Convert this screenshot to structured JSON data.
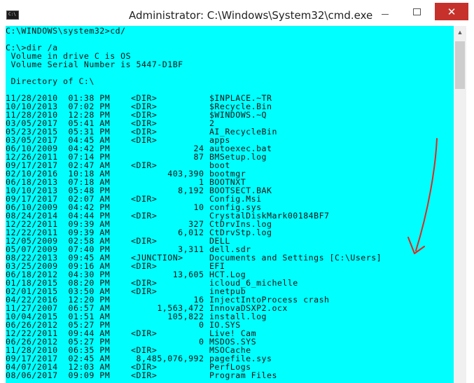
{
  "window": {
    "title": "Administrator: C:\\Windows\\System32\\cmd.exe",
    "icon_text": "C:\\",
    "controls": {
      "minimize": "minimize-icon",
      "maximize": "maximize-icon",
      "close": "✕"
    }
  },
  "colors": {
    "console_bg": "#00ffff",
    "console_text": "#111111",
    "close_bg": "#c7312b",
    "arrow": "#e0281e"
  },
  "console": {
    "lines": [
      "C:\\WINDOWS\\system32>cd/",
      "",
      "C:\\>dir /a",
      " Volume in drive C is OS",
      " Volume Serial Number is 5447-D1BF",
      "",
      " Directory of C:\\",
      "",
      "11/28/2010  01:38 PM    <DIR>          $INPLACE.~TR",
      "10/10/2013  07:02 PM    <DIR>          $Recycle.Bin",
      "11/28/2010  12:28 PM    <DIR>          $WINDOWS.~Q",
      "03/05/2017  05:41 AM    <DIR>          2",
      "05/23/2015  05:31 PM    <DIR>          AI_RecycleBin",
      "03/05/2017  04:45 AM    <DIR>          apps",
      "06/10/2009  04:42 PM                24 autoexec.bat",
      "12/26/2011  07:14 PM                87 BMSetup.log",
      "09/17/2017  02:47 AM    <DIR>          boot",
      "02/10/2016  10:18 AM           403,390 bootmgr",
      "06/18/2013  07:18 AM                 1 BOOTNXT",
      "10/10/2013  05:48 PM             8,192 BOOTSECT.BAK",
      "09/17/2017  02:07 AM    <DIR>          Config.Msi",
      "06/10/2009  04:42 PM                10 config.sys",
      "08/24/2014  04:44 PM    <DIR>          CrystalDiskMark00184BF7",
      "12/22/2011  09:39 AM               327 CtDrvIns.log",
      "12/22/2011  09:39 AM             6,012 CtDrvStp.log",
      "12/05/2009  02:58 AM    <DIR>          DELL",
      "05/07/2009  07:40 PM             3,311 dell.sdr",
      "08/22/2013  09:45 AM    <JUNCTION>     Documents and Settings [C:\\Users]",
      "03/25/2009  09:16 AM    <DIR>          EFI",
      "06/18/2012  04:30 PM            13,605 HCT.Log",
      "01/18/2015  08:20 PM    <DIR>          icloud_6_michelle",
      "02/01/2015  03:50 AM    <DIR>          inetpub",
      "04/22/2016  12:20 PM                16 InjectIntoProcess crash",
      "11/27/2007  06:57 AM         1,563,472 InnovaDSXP2.ocx",
      "10/04/2015  01:51 AM           105,822 install.log",
      "06/26/2012  05:27 PM                 0 IO.SYS",
      "12/22/2011  09:44 AM    <DIR>          Live! Cam",
      "06/26/2012  05:27 PM                 0 MSDOS.SYS",
      "11/28/2010  06:35 PM    <DIR>          MSOCache",
      "09/17/2017  02:45 AM     8,485,076,992 pagefile.sys",
      "04/07/2014  12:03 AM    <DIR>          PerfLogs",
      "08/06/2017  09:09 PM    <DIR>          Program Files"
    ]
  },
  "scrollbar": {
    "up_arrow": "▲"
  },
  "annotation": {
    "type": "arrow",
    "pointing_at": "Documents and Settings [C:\\Users]"
  }
}
